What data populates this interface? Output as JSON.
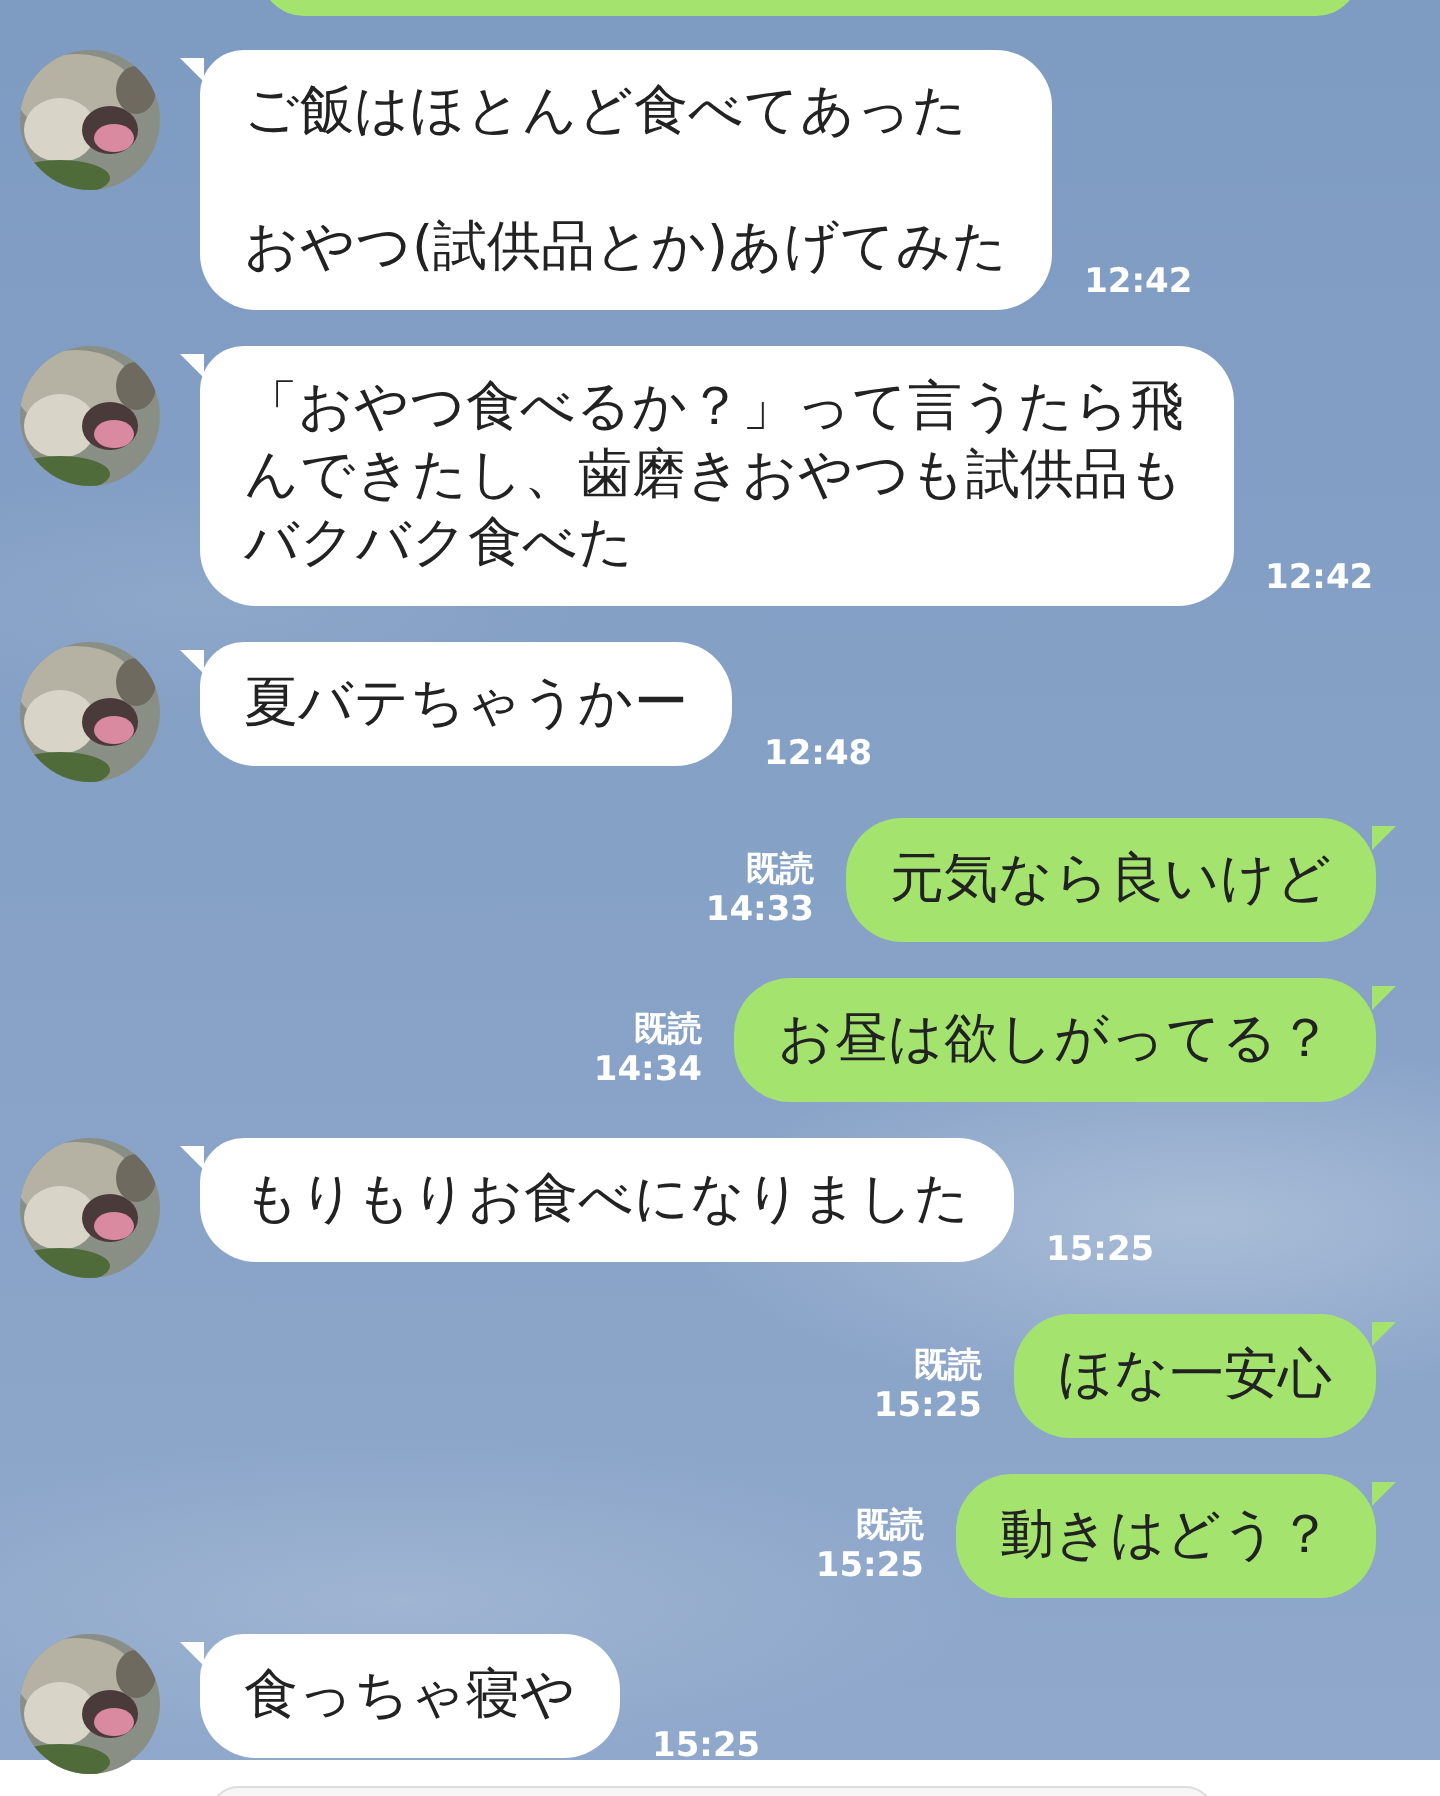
{
  "messages": [
    {
      "kind": "received",
      "lines": [
        "ご飯はほとんど食べてあった",
        "おやつ(試供品とか)あげてみた"
      ],
      "time": "12:42"
    },
    {
      "kind": "received",
      "lines": [
        "「おやつ食べるか？」って言うたら飛んできたし、歯磨きおやつも試供品もバクバク食べた"
      ],
      "time": "12:42"
    },
    {
      "kind": "received",
      "lines": [
        "夏バテちゃうかー"
      ],
      "time": "12:48"
    },
    {
      "kind": "sent",
      "read_label": "既読",
      "time": "14:33",
      "lines": [
        "元気なら良いけど"
      ]
    },
    {
      "kind": "sent",
      "read_label": "既読",
      "time": "14:34",
      "lines": [
        "お昼は欲しがってる？"
      ]
    },
    {
      "kind": "received",
      "lines": [
        "もりもりお食べになりました"
      ],
      "time": "15:25"
    },
    {
      "kind": "sent",
      "read_label": "既読",
      "time": "15:25",
      "lines": [
        "ほな一安心"
      ]
    },
    {
      "kind": "sent",
      "read_label": "既読",
      "time": "15:25",
      "lines": [
        "動きはどう？"
      ]
    },
    {
      "kind": "received",
      "lines": [
        "食っちゃ寝や"
      ],
      "time": "15:25"
    }
  ]
}
